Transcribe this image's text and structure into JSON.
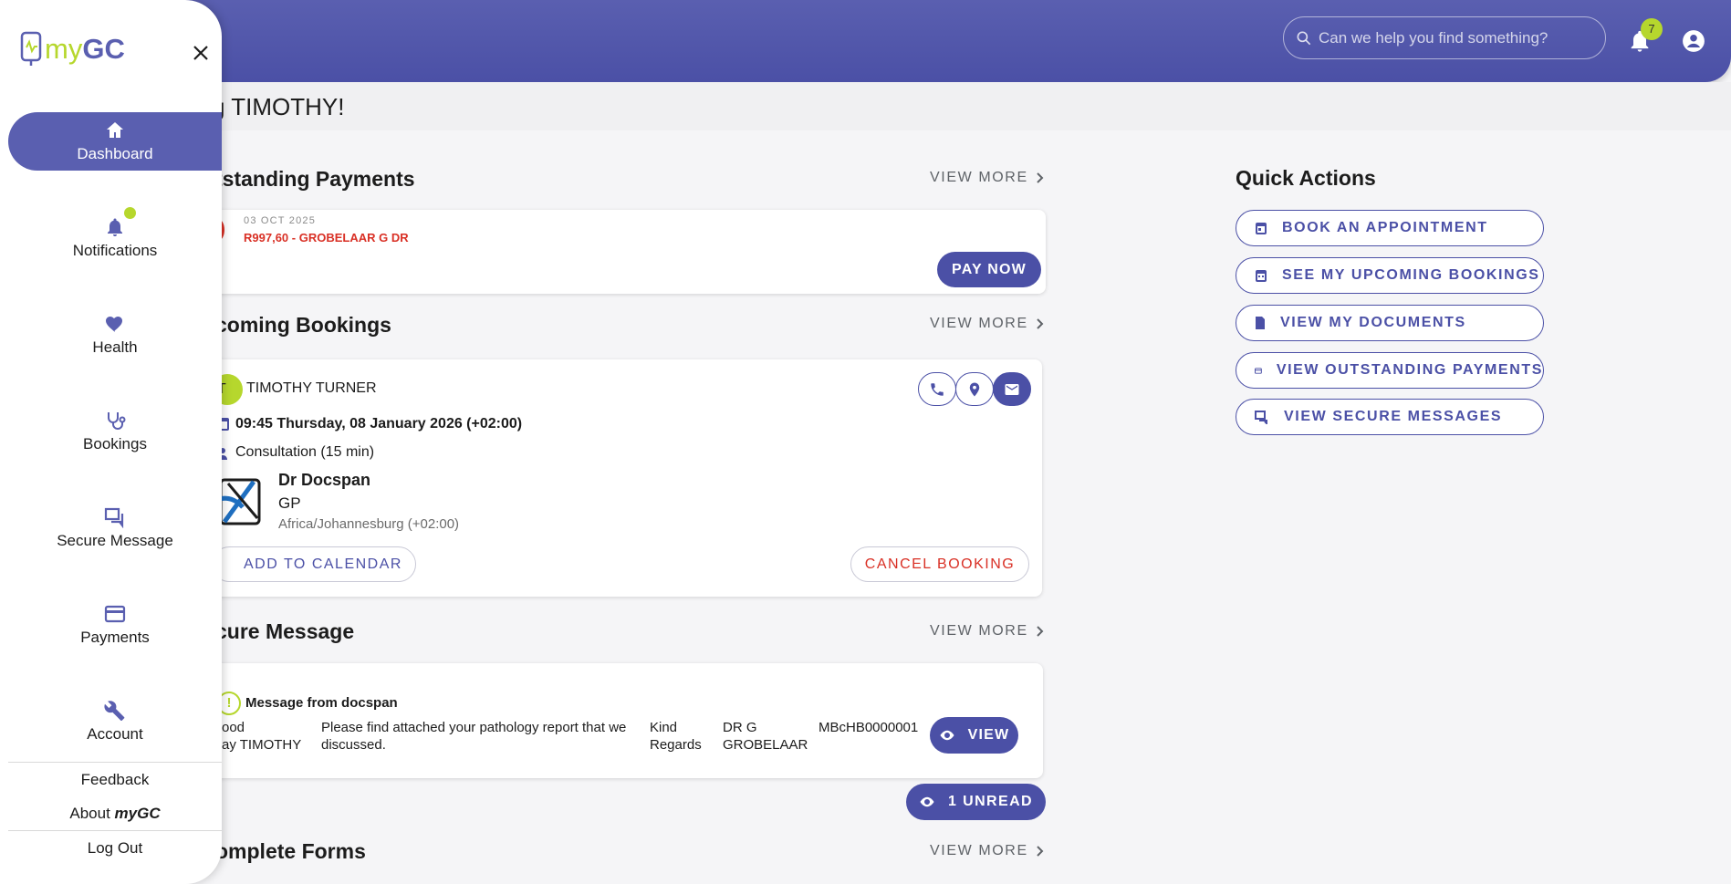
{
  "header": {
    "search_placeholder": "Can we help you find something?",
    "notification_count": "7"
  },
  "greeting": "g TIMOTHY!",
  "outstanding": {
    "title": "tstanding Payments",
    "view_more": "VIEW MORE",
    "date": "03 OCT 2025",
    "amount": "R997,60 - GROBELAAR G DR",
    "pay_label": "PAY NOW"
  },
  "bookings": {
    "title": "coming Bookings",
    "view_more": "VIEW MORE",
    "avatar_initials": "T",
    "patient": "TIMOTHY TURNER",
    "time": "09:45 Thursday, 08 January 2026 (+02:00)",
    "type": "Consultation (15 min)",
    "doctor_name": "Dr Docspan",
    "doctor_role": "GP",
    "timezone": "Africa/Johannesburg (+02:00)",
    "add_calendar": "ADD TO CALENDAR",
    "cancel": "CANCEL BOOKING"
  },
  "messages": {
    "title": "cure Message",
    "view_more": "VIEW MORE",
    "msg_title": "Message from docspan",
    "col1": "ood\nay TIMOTHY",
    "col2": "Please find attached your pathology report that we discussed.",
    "col3": "Kind Regards",
    "col4": "DR G GROBELAAR",
    "col5": "MBcHB0000001",
    "view_label": "VIEW",
    "unread_label": "1 UNREAD"
  },
  "forms": {
    "title": "omplete Forms",
    "view_more": "VIEW MORE"
  },
  "quick_actions": {
    "title": "Quick Actions",
    "items": [
      {
        "label": "BOOK AN APPOINTMENT",
        "icon": "calendar-icon"
      },
      {
        "label": "SEE MY UPCOMING BOOKINGS",
        "icon": "calendar-icon"
      },
      {
        "label": "VIEW MY DOCUMENTS",
        "icon": "document-icon"
      },
      {
        "label": "VIEW OUTSTANDING PAYMENTS",
        "icon": "card-icon"
      },
      {
        "label": "VIEW SECURE MESSAGES",
        "icon": "chat-icon"
      }
    ]
  },
  "sidebar": {
    "logo_my": "my",
    "logo_gc": "GC",
    "items": [
      {
        "label": "Dashboard",
        "icon": "home-icon"
      },
      {
        "label": "Notifications",
        "icon": "bell-icon"
      },
      {
        "label": "Health",
        "icon": "heart-icon"
      },
      {
        "label": "Bookings",
        "icon": "stethoscope-icon"
      },
      {
        "label": "Secure Message",
        "icon": "chat-icon"
      },
      {
        "label": "Payments",
        "icon": "card-icon"
      },
      {
        "label": "Account",
        "icon": "wrench-icon"
      }
    ],
    "feedback": "Feedback",
    "about_prefix": "About",
    "about_brand": "myGC",
    "logout": "Log Out"
  },
  "colors": {
    "primary": "#4b50a6",
    "accent": "#b6d72d",
    "danger": "#d93025"
  }
}
